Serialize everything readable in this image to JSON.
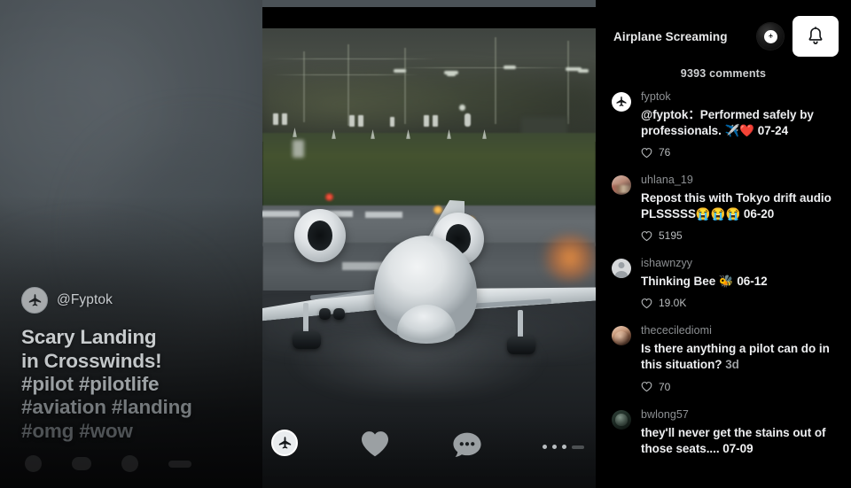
{
  "video_overlay": {
    "handle": "@Fyptok",
    "avatar_icon": "jet-icon",
    "caption_lines": [
      "Scary Landing",
      "in Crosswinds!",
      "#pilot #pilotlife",
      "#aviation #landing",
      "#omg #wow"
    ]
  },
  "action_bar": {
    "avatar_icon": "jet-avatar-icon",
    "like_icon": "heart-icon",
    "comment_icon": "comment-bubble-icon",
    "more_icon": "more-dots-icon"
  },
  "comments_panel": {
    "header": {
      "sound_title": "Airplane Screaming",
      "disc_icon": "music-disc-icon",
      "bell_icon": "bell-icon"
    },
    "count_label": "9393 comments",
    "items": [
      {
        "username": "fyptok",
        "avatar": "jet-icon",
        "text": "@fyptok：Performed safely by professionals. ✈️❤️",
        "date": "07-24",
        "likes": "76"
      },
      {
        "username": "uhlana_19",
        "avatar": "photo-avatar",
        "text": "Repost this with Tokyo drift audio PLSSSSS😭😭😭",
        "date": "06-20",
        "likes": "5195"
      },
      {
        "username": "ishawnzyy",
        "avatar": "default-avatar",
        "text": "Thinking Bee 🐝",
        "date": "06-12",
        "likes": "19.0K"
      },
      {
        "username": "thececilediomi",
        "avatar": "photo-avatar",
        "text": "Is there anything a pilot can do in this situation?",
        "date": "3d",
        "likes": "70"
      },
      {
        "username": "bwlong57",
        "avatar": "photo-avatar",
        "text": "they'll never get the stains out of those seats....",
        "date": "07-09",
        "likes": ""
      }
    ]
  },
  "colors": {
    "panel_bg": "#000000",
    "text_primary": "#edeef0",
    "text_secondary": "#8d9093",
    "accent_white": "#ffffff"
  }
}
